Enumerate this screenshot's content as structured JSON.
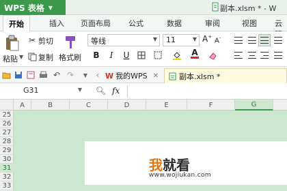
{
  "app": {
    "menu_label": "WPS 表格",
    "title": "副本.xlsm * - W"
  },
  "ribbon_tabs": [
    "开始",
    "插入",
    "页面布局",
    "公式",
    "数据",
    "审阅",
    "视图",
    "云服"
  ],
  "clipboard": {
    "paste": "粘贴",
    "cut": "剪切",
    "copy": "复制",
    "format_painter": "格式刷"
  },
  "font": {
    "name": "等线",
    "size": "11"
  },
  "format_buttons": [
    "B",
    "I",
    "U"
  ],
  "quick_access": [
    "open-icon",
    "save-icon",
    "print-preview-icon",
    "print-icon",
    "undo-icon",
    "redo-icon"
  ],
  "doc_tabs": [
    {
      "label": "我的WPS",
      "icon": "wps-logo-icon"
    },
    {
      "label": "副本.xlsm *",
      "icon": "sheet-icon"
    }
  ],
  "formula_bar": {
    "cell_ref": "G31",
    "fx": "fx",
    "value": ""
  },
  "sheet": {
    "columns": [
      "A",
      "B",
      "C",
      "D",
      "E",
      "F",
      "G"
    ],
    "rows": [
      "25",
      "26",
      "27",
      "28",
      "29",
      "30",
      "31",
      "32",
      "33"
    ],
    "selected_column": "G",
    "selected_row": "31"
  },
  "watermark": {
    "logo_a": "我",
    "logo_b": "就看",
    "url": "www.wojiukan.com"
  },
  "colors": {
    "accent": "#3a9a4a",
    "sheet_bg": "#cbe8cf",
    "logo_orange": "#e8760c"
  }
}
